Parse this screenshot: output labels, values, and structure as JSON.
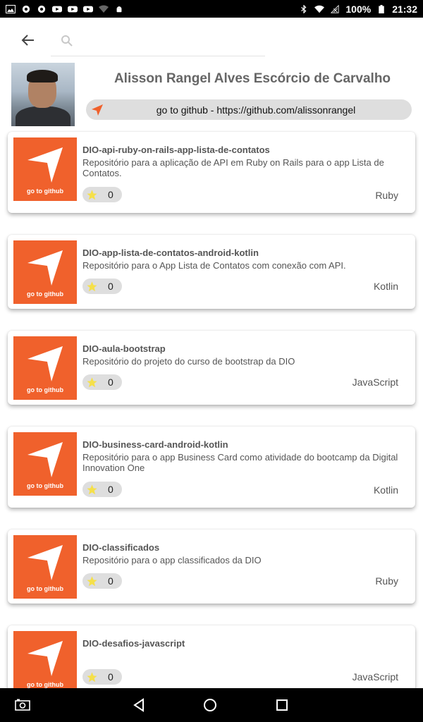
{
  "status_bar": {
    "battery": "100%",
    "time": "21:32"
  },
  "search": {
    "placeholder": "",
    "value": ""
  },
  "profile": {
    "name": "Alisson Rangel Alves Escórcio de Carvalho",
    "github_link": "go to github - https://github.com/alissonrangel"
  },
  "accent_color": "#f0612c",
  "repos": [
    {
      "title": "DIO-api-ruby-on-rails-app-lista-de-contatos",
      "description": "Repositório para a aplicação de API em Ruby on Rails para o app Lista de Contatos.",
      "thumb_label": "go to github",
      "stars": "0",
      "language": "Ruby"
    },
    {
      "title": "DIO-app-lista-de-contatos-android-kotlin",
      "description": "Repositório para o App Lista de Contatos com conexão com API.",
      "thumb_label": "go to github",
      "stars": "0",
      "language": "Kotlin"
    },
    {
      "title": "DIO-aula-bootstrap",
      "description": "Repositório do projeto do curso de bootstrap da DIO",
      "thumb_label": "go to github",
      "stars": "0",
      "language": "JavaScript"
    },
    {
      "title": "DIO-business-card-android-kotlin",
      "description": "Repositório para o app Business Card como atividade do bootcamp da Digital Innovation One",
      "thumb_label": "go to github",
      "stars": "0",
      "language": "Kotlin"
    },
    {
      "title": "DIO-classificados",
      "description": "Repositório para o app classificados da DIO",
      "thumb_label": "go to github",
      "stars": "0",
      "language": "Ruby"
    },
    {
      "title": "DIO-desafios-javascript",
      "description": "",
      "thumb_label": "go to github",
      "stars": "0",
      "language": "JavaScript"
    }
  ]
}
